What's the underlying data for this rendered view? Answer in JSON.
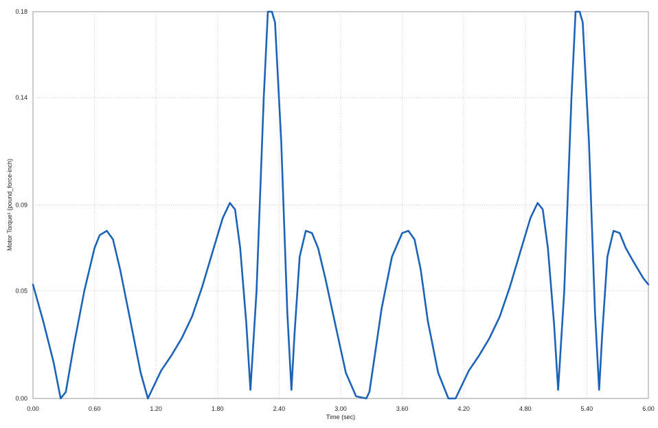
{
  "chart_data": {
    "type": "line",
    "xlabel": "Time (sec)",
    "ylabel": "Motor Torque¹ (pound_force-inch)",
    "xlim": [
      0,
      6
    ],
    "ylim": [
      0,
      0.18
    ],
    "x_ticks": [
      "0.00",
      "0.60",
      "1.20",
      "1.80",
      "2.40",
      "3.00",
      "3.60",
      "4.20",
      "4.80",
      "5.40",
      "6.00"
    ],
    "y_ticks": [
      "0.00",
      "0.05",
      "0.09",
      "0.14",
      "0.18"
    ],
    "grid": true,
    "series": [
      {
        "color": "#1a63b8",
        "x": [
          0.0,
          0.1,
          0.2,
          0.27,
          0.32,
          0.4,
          0.5,
          0.6,
          0.65,
          0.72,
          0.78,
          0.85,
          0.95,
          1.05,
          1.12,
          1.17,
          1.25,
          1.35,
          1.45,
          1.55,
          1.65,
          1.75,
          1.85,
          1.92,
          1.97,
          2.02,
          2.08,
          2.12,
          2.18,
          2.25,
          2.29,
          2.33,
          2.36,
          2.42,
          2.48,
          2.52,
          2.55,
          2.6,
          2.66,
          2.72,
          2.78,
          2.85,
          2.95,
          3.05,
          3.15,
          3.25,
          3.28,
          3.32,
          3.4,
          3.5,
          3.6,
          3.66,
          3.72,
          3.78,
          3.85,
          3.95,
          4.05,
          4.12,
          4.17,
          4.25,
          4.35,
          4.45,
          4.55,
          4.65,
          4.75,
          4.85,
          4.92,
          4.97,
          5.02,
          5.08,
          5.12,
          5.18,
          5.25,
          5.29,
          5.33,
          5.36,
          5.42,
          5.48,
          5.52,
          5.55,
          5.6,
          5.66,
          5.72,
          5.78,
          5.85,
          5.95,
          6.0
        ],
        "values": [
          0.053,
          0.036,
          0.017,
          0.0,
          0.003,
          0.025,
          0.05,
          0.07,
          0.076,
          0.078,
          0.074,
          0.06,
          0.036,
          0.012,
          0.0,
          0.005,
          0.013,
          0.02,
          0.028,
          0.038,
          0.052,
          0.068,
          0.084,
          0.091,
          0.088,
          0.07,
          0.035,
          0.004,
          0.05,
          0.14,
          0.18,
          0.18,
          0.175,
          0.12,
          0.04,
          0.004,
          0.03,
          0.066,
          0.078,
          0.077,
          0.07,
          0.056,
          0.034,
          0.012,
          0.001,
          0.0,
          0.003,
          0.016,
          0.042,
          0.066,
          0.077,
          0.078,
          0.074,
          0.06,
          0.036,
          0.012,
          0.0,
          0.0,
          0.005,
          0.013,
          0.02,
          0.028,
          0.038,
          0.052,
          0.068,
          0.084,
          0.091,
          0.088,
          0.07,
          0.035,
          0.004,
          0.05,
          0.14,
          0.18,
          0.18,
          0.175,
          0.12,
          0.04,
          0.004,
          0.03,
          0.066,
          0.078,
          0.077,
          0.07,
          0.064,
          0.056,
          0.053
        ]
      }
    ]
  }
}
